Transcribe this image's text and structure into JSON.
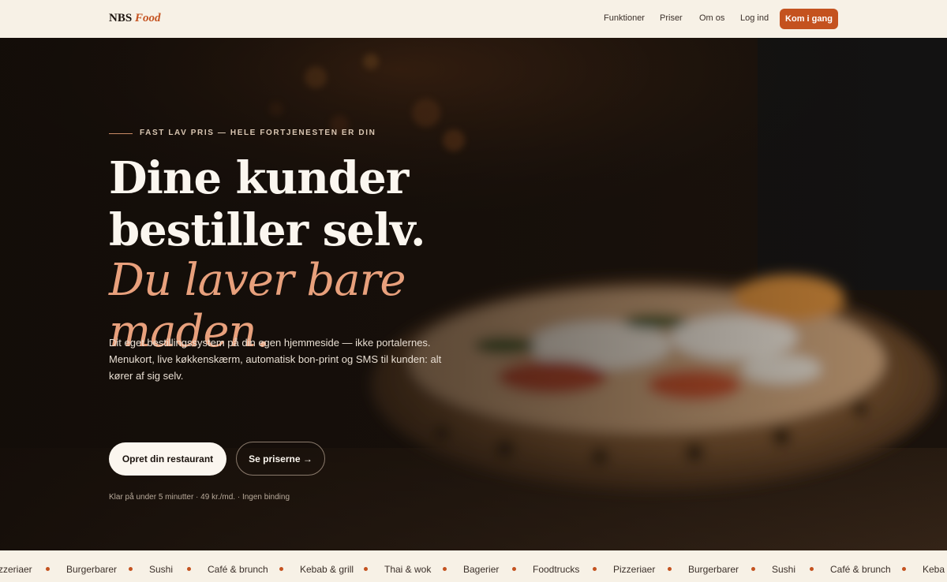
{
  "header": {
    "logo_primary": "NBS",
    "logo_accent": "Food",
    "nav": [
      "Funktioner",
      "Priser",
      "Om os",
      "Log ind"
    ],
    "cta": "Kom i gang",
    "accent_color": "#c4521f"
  },
  "hero": {
    "eyebrow": "FAST LAV PRIS — HELE FORTJENESTEN ER DIN",
    "headline_line1": "Dine kunder",
    "headline_line2": "bestiller selv.",
    "headline_accent_line1": "Du laver bare",
    "headline_accent_line2": "maden.",
    "lead": "Dit eget bestillingssystem på din egen hjemmeside — ikke portalernes. Menukort, live køkkenskærm, automatisk bon-print og SMS til kunden: alt kører af sig selv.",
    "primary_button": "Opret din restaurant",
    "secondary_button": "Se priserne →",
    "note": "Klar på under 5 minutter · 49 kr./md. · Ingen binding"
  },
  "marquee": {
    "items": [
      "zzeriaer",
      "Burgerbarer",
      "Sushi",
      "Café & brunch",
      "Kebab & grill",
      "Thai & wok",
      "Bagerier",
      "Foodtrucks",
      "Pizzeriaer",
      "Burgerbarer",
      "Sushi",
      "Café & brunch",
      "Keba"
    ]
  }
}
